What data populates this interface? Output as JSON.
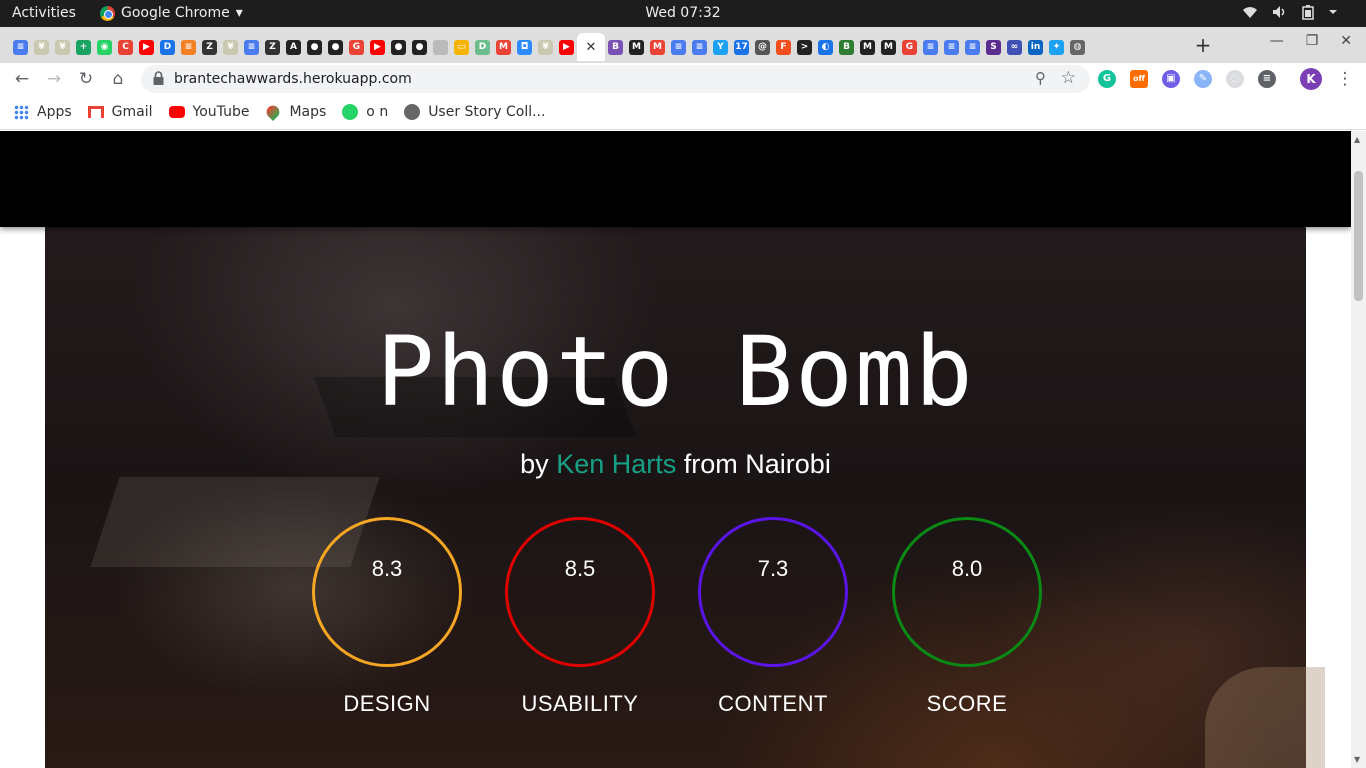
{
  "system": {
    "activities": "Activities",
    "app_name": "Google Chrome",
    "app_menu_arrow": "▾",
    "clock": "Wed 07:32"
  },
  "browser": {
    "tab_favicons": [
      {
        "icon": "google-docs-icon",
        "color": "#4a7cf0",
        "glyph": "≡"
      },
      {
        "icon": "palm-tree-icon",
        "color": "#c9c9b0",
        "glyph": "¥"
      },
      {
        "icon": "palm-tree-icon",
        "color": "#c9c9b0",
        "glyph": "¥"
      },
      {
        "icon": "plus-green-icon",
        "color": "#19a463",
        "glyph": "+"
      },
      {
        "icon": "whatsapp-icon",
        "color": "#25d366",
        "glyph": "◉"
      },
      {
        "icon": "calendar-icon",
        "color": "#e94235",
        "glyph": "C"
      },
      {
        "icon": "youtube-icon",
        "color": "#ff0000",
        "glyph": "▶"
      },
      {
        "icon": "d-icon",
        "color": "#1a73e8",
        "glyph": "D"
      },
      {
        "icon": "stack-icon",
        "color": "#f48024",
        "glyph": "≡"
      },
      {
        "icon": "zeplin-icon",
        "color": "#333333",
        "glyph": "Z"
      },
      {
        "icon": "palm-tree-icon",
        "color": "#c9c9b0",
        "glyph": "¥"
      },
      {
        "icon": "google-docs-icon",
        "color": "#4a7cf0",
        "glyph": "≡"
      },
      {
        "icon": "zeplin-icon",
        "color": "#333333",
        "glyph": "Z"
      },
      {
        "icon": "angular-icon",
        "color": "#222222",
        "glyph": "A"
      },
      {
        "icon": "github-icon",
        "color": "#222222",
        "glyph": "●"
      },
      {
        "icon": "github-icon",
        "color": "#222222",
        "glyph": "●"
      },
      {
        "icon": "google-icon",
        "color": "#ea4335",
        "glyph": "G"
      },
      {
        "icon": "youtube-icon",
        "color": "#ff0000",
        "glyph": "▶"
      },
      {
        "icon": "github-icon",
        "color": "#222222",
        "glyph": "●"
      },
      {
        "icon": "github-icon",
        "color": "#222222",
        "glyph": "●"
      },
      {
        "icon": "blank-page-icon",
        "color": "#bbbbbb",
        "glyph": " "
      },
      {
        "icon": "slides-icon",
        "color": "#f4b400",
        "glyph": "▭"
      },
      {
        "icon": "d-green-icon",
        "color": "#6cbf8c",
        "glyph": "D"
      },
      {
        "icon": "gmail-icon",
        "color": "#ea4335",
        "glyph": "M"
      },
      {
        "icon": "zoom-icon",
        "color": "#2d8cff",
        "glyph": "◘"
      },
      {
        "icon": "palm-tree-icon",
        "color": "#c9c9b0",
        "glyph": "¥"
      },
      {
        "icon": "youtube-icon",
        "color": "#ff0000",
        "glyph": "▶"
      },
      {
        "icon": "close-icon",
        "color": "#ffffff",
        "glyph": "✕"
      },
      {
        "icon": "bootstrap-icon",
        "color": "#7952b3",
        "glyph": "B"
      },
      {
        "icon": "medium-icon",
        "color": "#222222",
        "glyph": "M"
      },
      {
        "icon": "gmail-icon",
        "color": "#ea4335",
        "glyph": "M"
      },
      {
        "icon": "google-docs-icon",
        "color": "#4a7cf0",
        "glyph": "≡"
      },
      {
        "icon": "google-docs-icon",
        "color": "#4a7cf0",
        "glyph": "≡"
      },
      {
        "icon": "filter-icon",
        "color": "#1da1f2",
        "glyph": "Y"
      },
      {
        "icon": "calendar-17-icon",
        "color": "#1a73e8",
        "glyph": "17"
      },
      {
        "icon": "spiral-icon",
        "color": "#555555",
        "glyph": "@"
      },
      {
        "icon": "figma-icon",
        "color": "#f24e1e",
        "glyph": "F"
      },
      {
        "icon": "terminal-icon",
        "color": "#222222",
        "glyph": ">"
      },
      {
        "icon": "chat-icon",
        "color": "#1a73e8",
        "glyph": "◐"
      },
      {
        "icon": "bank-icon",
        "color": "#2e7d32",
        "glyph": "B"
      },
      {
        "icon": "medium-icon",
        "color": "#222222",
        "glyph": "M"
      },
      {
        "icon": "medium-icon",
        "color": "#222222",
        "glyph": "M"
      },
      {
        "icon": "google-icon",
        "color": "#ea4335",
        "glyph": "G"
      },
      {
        "icon": "google-docs-icon",
        "color": "#4a7cf0",
        "glyph": "≡"
      },
      {
        "icon": "google-docs-icon",
        "color": "#4a7cf0",
        "glyph": "≡"
      },
      {
        "icon": "google-docs-icon",
        "color": "#4a7cf0",
        "glyph": "≡"
      },
      {
        "icon": "s-icon",
        "color": "#5b2d8e",
        "glyph": "S"
      },
      {
        "icon": "loop-icon",
        "color": "#3f51b5",
        "glyph": "∞"
      },
      {
        "icon": "linkedin-icon",
        "color": "#0a66c2",
        "glyph": "in"
      },
      {
        "icon": "twitter-icon",
        "color": "#1da1f2",
        "glyph": "✦"
      },
      {
        "icon": "globe-icon",
        "color": "#666666",
        "glyph": "◍"
      }
    ],
    "active_tab_index": 27,
    "new_tab_label": "+",
    "url": "brantechawwards.herokuapp.com",
    "extensions": [
      {
        "icon": "grammarly-icon",
        "color": "#15c39a",
        "glyph": "G"
      },
      {
        "icon": "off-badge-icon",
        "color": "#ff6d00",
        "glyph": "off"
      },
      {
        "icon": "meet-icon",
        "color": "#6f5ee6",
        "glyph": "▣"
      },
      {
        "icon": "edit-icon",
        "color": "#8ab4f8",
        "glyph": "✎"
      },
      {
        "icon": "sync-icon",
        "color": "#dadce0",
        "glyph": "◌"
      },
      {
        "icon": "playlist-icon",
        "color": "#5f6368",
        "glyph": "≡"
      }
    ],
    "profile_initial": "K",
    "profile_color": "#7b3fb5"
  },
  "bookmarks": [
    {
      "label": "Apps",
      "icon": "apps-grid-icon"
    },
    {
      "label": "Gmail",
      "icon": "gmail-icon"
    },
    {
      "label": "YouTube",
      "icon": "youtube-icon"
    },
    {
      "label": "Maps",
      "icon": "maps-pin-icon"
    },
    {
      "label": "o n",
      "icon": "whatsapp-icon"
    },
    {
      "label": "User Story Coll...",
      "icon": "globe-icon"
    }
  ],
  "page": {
    "title": "Photo Bomb",
    "by": "by",
    "author": "Ken Harts",
    "location_text": "from Nairobi",
    "author_color": "#16a085",
    "metrics": [
      {
        "value": "8.3",
        "label": "DESIGN",
        "color": "#f5a623"
      },
      {
        "value": "8.5",
        "label": "USABILITY",
        "color": "#e00000"
      },
      {
        "value": "7.3",
        "label": "CONTENT",
        "color": "#5a14e6"
      },
      {
        "value": "8.0",
        "label": "SCORE",
        "color": "#0a8a14"
      }
    ]
  }
}
